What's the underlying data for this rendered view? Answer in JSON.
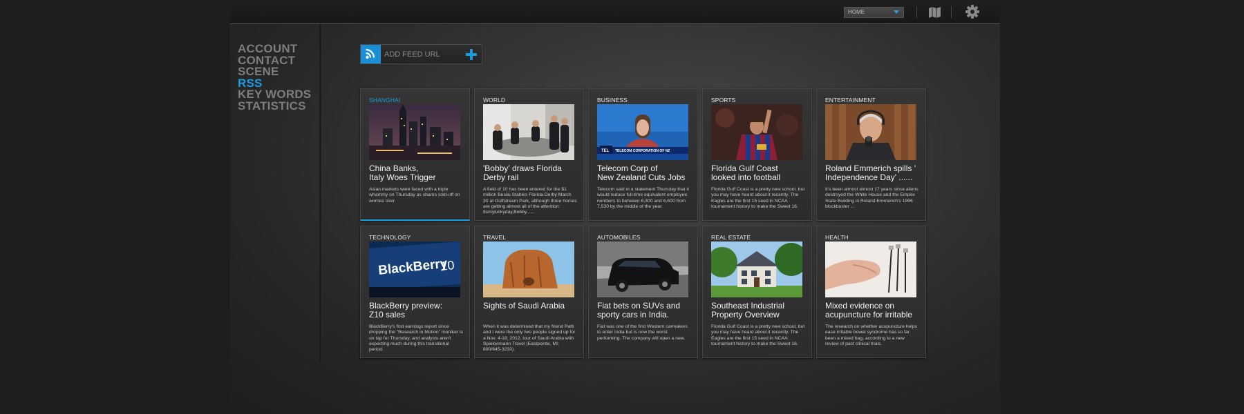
{
  "topbar": {
    "location_select": "HOME",
    "icons": [
      "map-icon",
      "gear-icon"
    ]
  },
  "nav": {
    "items": [
      {
        "label": "ACCOUNT",
        "active": false
      },
      {
        "label": "CONTACT",
        "active": false
      },
      {
        "label": "SCENE",
        "active": false
      },
      {
        "label": "RSS",
        "active": true
      },
      {
        "label": "KEY WORDS",
        "active": false
      },
      {
        "label": "STATISTICS",
        "active": false
      }
    ]
  },
  "feed": {
    "placeholder": "ADD FEED URL",
    "icons": [
      "rss-icon",
      "plus-icon"
    ]
  },
  "colors": {
    "accent": "#1a9be0",
    "card_bg": "#323232",
    "nav_text": "#7d7d7d"
  },
  "cards": [
    {
      "category": "SHANGHAI",
      "active": true,
      "headline": "China Banks,\nItaly Woes Trigger",
      "summary": "Asian markets were faced with a triple whammy on Thursday as shares sold-off on worries over",
      "image": "city-night-skyline"
    },
    {
      "category": "WORLD",
      "active": false,
      "headline": "'Bobby' draws Florida\nDerby rail",
      "summary": "A field of 10 has been entered for the $1 million Besilu Stables Florida Derby March 30 at Gulfstream Park, although three horses are getting almost all of the attention: Itsmyluckyday,Bobby......",
      "image": "meeting-room"
    },
    {
      "category": "BUSINESS",
      "active": false,
      "headline": "Telecom Corp of\nNew Zealand Cuts Jobs",
      "summary": "Telecom said in a statement Thursday that it would reduce full-time equivalent employee numbers to between 6,300 and 6,600 from 7,530 by the middle of the year.",
      "image": "news-anchor"
    },
    {
      "category": "SPORTS",
      "active": false,
      "headline": "Florida Gulf Coast\nlooked into football",
      "summary": "Florida Gulf Coast is a pretty new school, but you may have heard about it recently. The Eagles are the first 15 seed in NCAA tournament history to make the Sweet 16.",
      "image": "football-player"
    },
    {
      "category": "ENTERTAINMENT",
      "active": false,
      "headline": "Roland Emmerich spills '\nIndependence Day' ......",
      "summary": "It's been almost almost 17 years since aliens destroyed the White House and the Empire State Building in Roland Emmerich's 1996 blockbuster ...",
      "image": "man-microphone"
    },
    {
      "category": "TECHNOLOGY",
      "active": false,
      "headline": "BlackBerry preview:\nZ10 sales",
      "summary": "BlackBerry's first earnings report since dropping the \"Research in Motion\" moniker is on tap for Thursday, and analysts aren't expecting much during this transitional period.",
      "image": "blackberry-10-banner"
    },
    {
      "category": "TRAVEL",
      "active": false,
      "headline": "Sights of Saudi Arabia",
      "summary": "When it was determined that my friend Patti and I were the only two people signed up for a Nov. 4-18, 2012, tour of Saudi Arabia with Spiekermann Travel (Eastpointe, MI; 800/645-3233).",
      "image": "desert-rock"
    },
    {
      "category": "AUTOMOBILES",
      "active": false,
      "headline": "Fiat bets on SUVs and\nsporty cars in India.",
      "summary": "Fiat was one of the first Western carmakers to enter India but is now the worst performing. The company will open a new.",
      "image": "black-suv"
    },
    {
      "category": "REAL ESTATE",
      "active": false,
      "headline": "Southeast Industrial\nProperty Overview",
      "summary": "Florida Gulf Coast is a pretty new school, but you may have heard about it recently. The Eagles are the first 15 seed in NCAA tournament history to make the Sweet 16.",
      "image": "house"
    },
    {
      "category": "HEALTH",
      "active": false,
      "headline": "Mixed evidence on\nacupuncture for irritable",
      "summary": "The research on whether acupuncture helps ease irritable bowel syndrome has so far been a mixed bag, according to a new review of past clinical trials.",
      "image": "acupuncture-hand"
    }
  ],
  "thumb_text": {
    "news_ticker": "TELECOM CORPORATION OF NZ",
    "news_logo": "TEL",
    "bb_brand": "BlackBerry",
    "bb_version": "10"
  }
}
